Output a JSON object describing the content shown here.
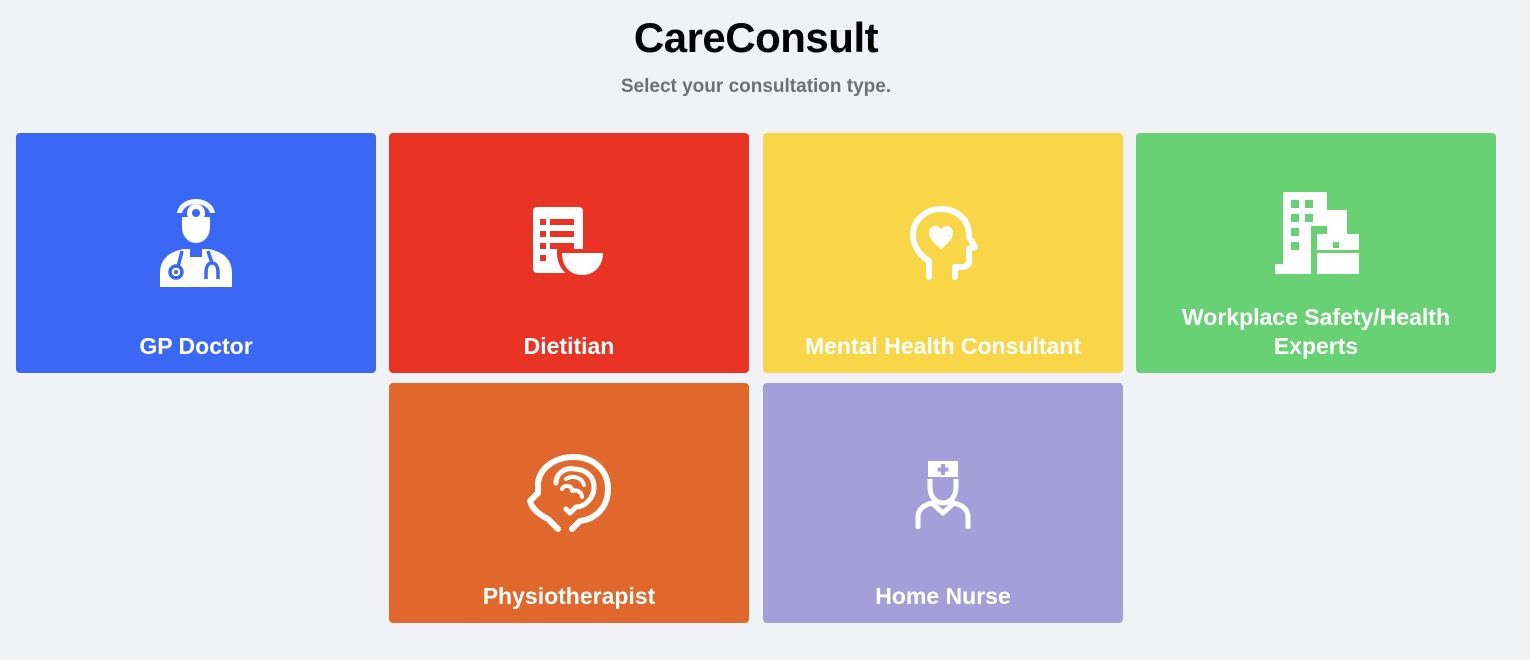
{
  "header": {
    "title": "CareConsult",
    "subtitle": "Select your consultation type."
  },
  "cards": [
    {
      "label": "GP Doctor",
      "color": "#3a68f5",
      "icon": "doctor-icon"
    },
    {
      "label": "Dietitian",
      "color": "#e93324",
      "icon": "diet-menu-icon"
    },
    {
      "label": "Mental Health Consultant",
      "color": "#f8d648",
      "icon": "head-heart-icon"
    },
    {
      "label": "Workplace Safety/Health Experts",
      "color": "#67d173",
      "icon": "building-icon"
    },
    {
      "label": "Physiotherapist",
      "color": "#e0682c",
      "icon": "head-brain-icon"
    },
    {
      "label": "Home Nurse",
      "color": "#a69ed8",
      "icon": "nurse-icon"
    }
  ]
}
